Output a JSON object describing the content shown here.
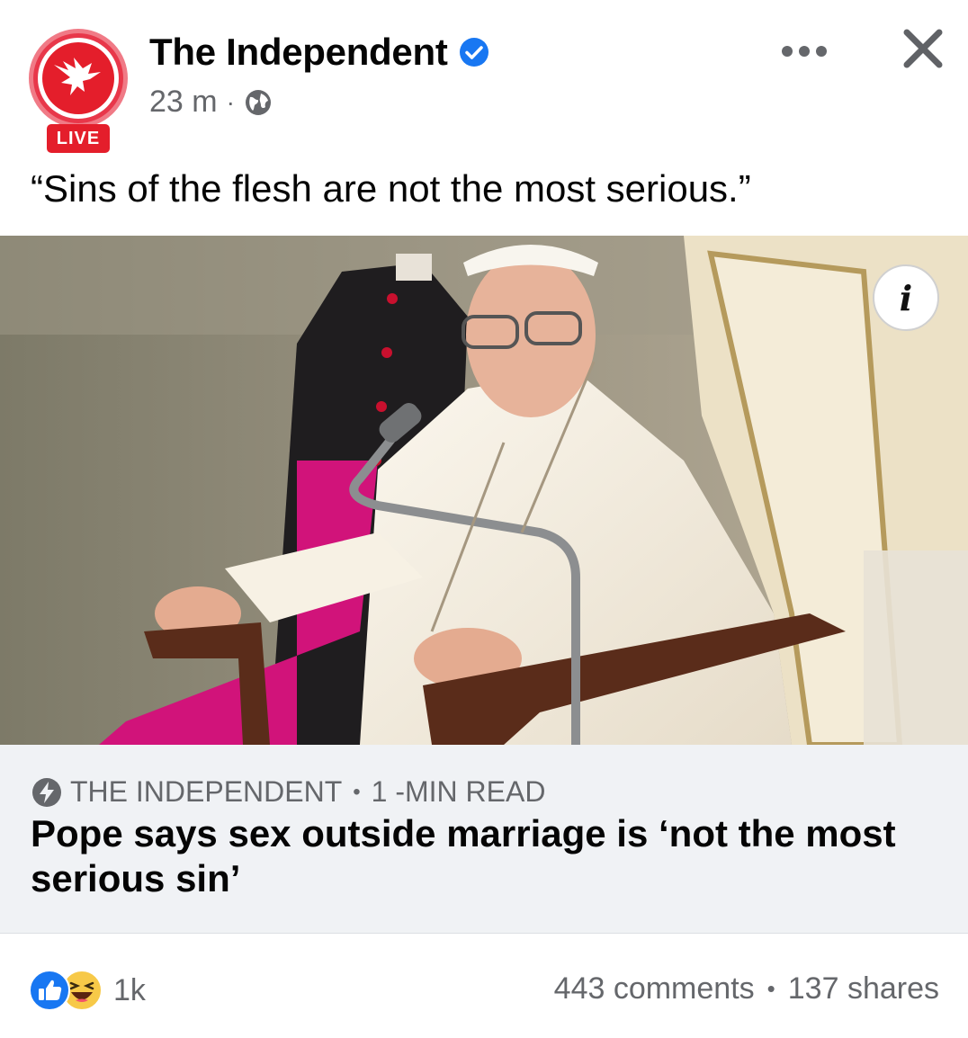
{
  "post": {
    "page_name": "The Independent",
    "time": "23 m",
    "meta_separator": "·",
    "live_label": "LIVE",
    "text": "“Sins of the flesh are not the most serious.”",
    "icons": {
      "avatar": "independent-eagle-logo",
      "verified": "verified-badge-icon",
      "audience": "globe-icon",
      "more": "more-options-icon",
      "close": "close-icon",
      "info": "info-icon"
    }
  },
  "link_preview": {
    "source": "THE INDEPENDENT",
    "separator": "•",
    "read_time": "1 -MIN READ",
    "headline": "Pope says sex outside marriage is ‘not the most serious sin’",
    "info_symbol": "i",
    "icon": "instant-article-bolt-icon"
  },
  "footer": {
    "reaction_count": "1k",
    "comments": "443 comments",
    "separator": "•",
    "shares": "137 shares",
    "reaction_icons": [
      "like-icon",
      "haha-icon"
    ]
  },
  "colors": {
    "brand_red": "#e41e2b",
    "verified_blue": "#1877f2",
    "secondary_text": "#65676b",
    "preview_bg": "#f0f2f5"
  }
}
